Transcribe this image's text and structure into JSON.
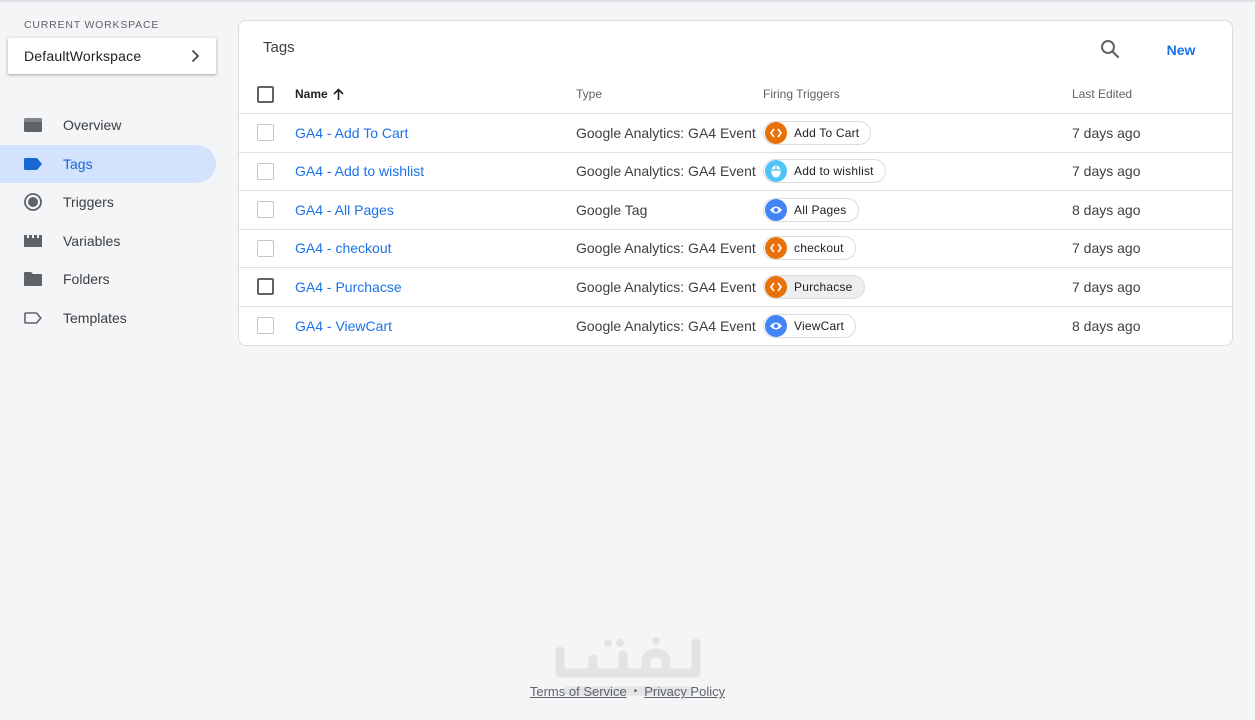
{
  "sidebar": {
    "workspace_label": "CURRENT WORKSPACE",
    "workspace_name": "DefaultWorkspace",
    "items": [
      {
        "label": "Overview",
        "icon": "overview-icon",
        "active": false
      },
      {
        "label": "Tags",
        "icon": "tag-icon",
        "active": true
      },
      {
        "label": "Triggers",
        "icon": "trigger-icon",
        "active": false
      },
      {
        "label": "Variables",
        "icon": "variables-icon",
        "active": false
      },
      {
        "label": "Folders",
        "icon": "folder-icon",
        "active": false
      },
      {
        "label": "Templates",
        "icon": "template-icon",
        "active": false
      }
    ]
  },
  "tags_panel": {
    "title": "Tags",
    "new_label": "New",
    "columns": {
      "name": "Name",
      "type": "Type",
      "firing_triggers": "Firing Triggers",
      "last_edited": "Last Edited"
    },
    "rows": [
      {
        "name": "GA4 - Add To Cart",
        "type": "Google Analytics: GA4 Event",
        "trigger": "Add To Cart",
        "trigger_icon": "custom-event-icon",
        "last_edited": "7 days ago"
      },
      {
        "name": "GA4 - Add to wishlist",
        "type": "Google Analytics: GA4 Event",
        "trigger": "Add to wishlist",
        "trigger_icon": "click-icon",
        "last_edited": "7 days ago"
      },
      {
        "name": "GA4 - All Pages",
        "type": "Google Tag",
        "trigger": "All Pages",
        "trigger_icon": "pageview-icon",
        "last_edited": "8 days ago"
      },
      {
        "name": "GA4 - checkout",
        "type": "Google Analytics: GA4 Event",
        "trigger": "checkout",
        "trigger_icon": "custom-event-icon",
        "last_edited": "7 days ago"
      },
      {
        "name": "GA4 - Purchacse",
        "type": "Google Analytics: GA4 Event",
        "trigger": "Purchacse",
        "trigger_icon": "custom-event-icon",
        "last_edited": "7 days ago"
      },
      {
        "name": "GA4 - ViewCart",
        "type": "Google Analytics: GA4 Event",
        "trigger": "ViewCart",
        "trigger_icon": "pageview-icon",
        "last_edited": "8 days ago"
      }
    ]
  },
  "footer": {
    "terms": "Terms of Service",
    "separator": "•",
    "privacy": "Privacy Policy"
  },
  "colors": {
    "accent": "#1a73e8",
    "active_nav_bg": "#d3e3fd",
    "custom_event": "#e8710a",
    "pageview": "#4285f4",
    "click": "#4fc3f7"
  }
}
